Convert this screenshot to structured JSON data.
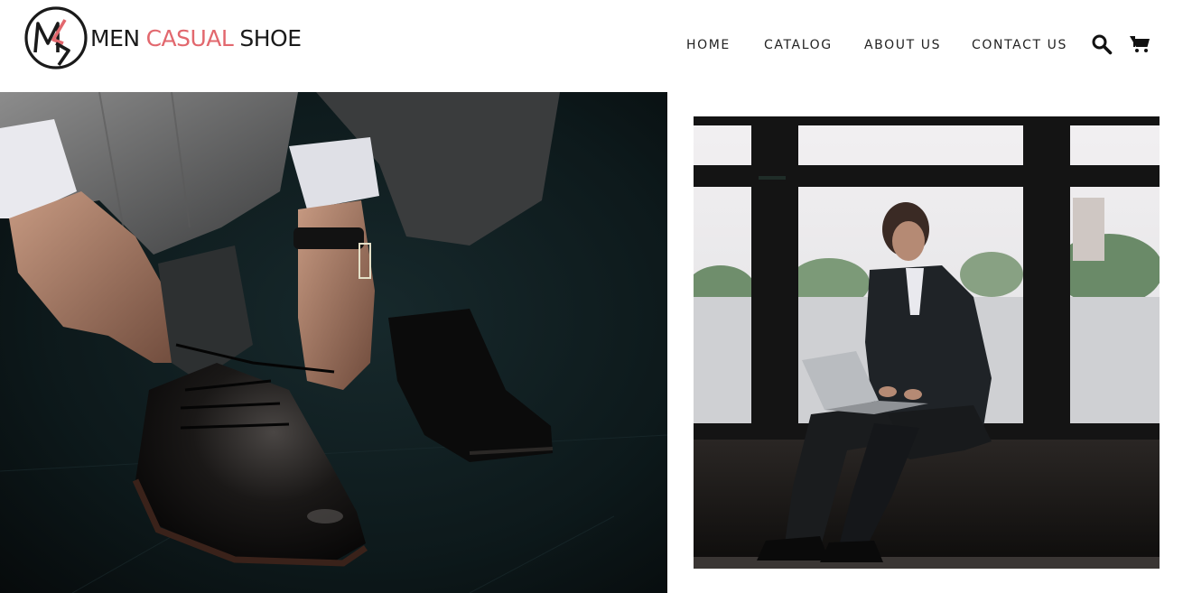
{
  "brand": {
    "logo_word_1": "MEN",
    "logo_word_2": "CASUAL",
    "logo_word_3": "SHOE",
    "accent_color": "#e2686e",
    "text_color": "#1a1a1a"
  },
  "nav": {
    "items": [
      {
        "label": "HOME"
      },
      {
        "label": "CATALOG"
      },
      {
        "label": "ABOUT US"
      },
      {
        "label": "CONTACT US"
      }
    ]
  },
  "header_icons": {
    "search": "search-icon",
    "cart": "cart-icon"
  },
  "hero": {
    "left_image": "man-tying-leather-shoe-photo",
    "right_image": "businessman-with-laptop-by-window-photo"
  }
}
